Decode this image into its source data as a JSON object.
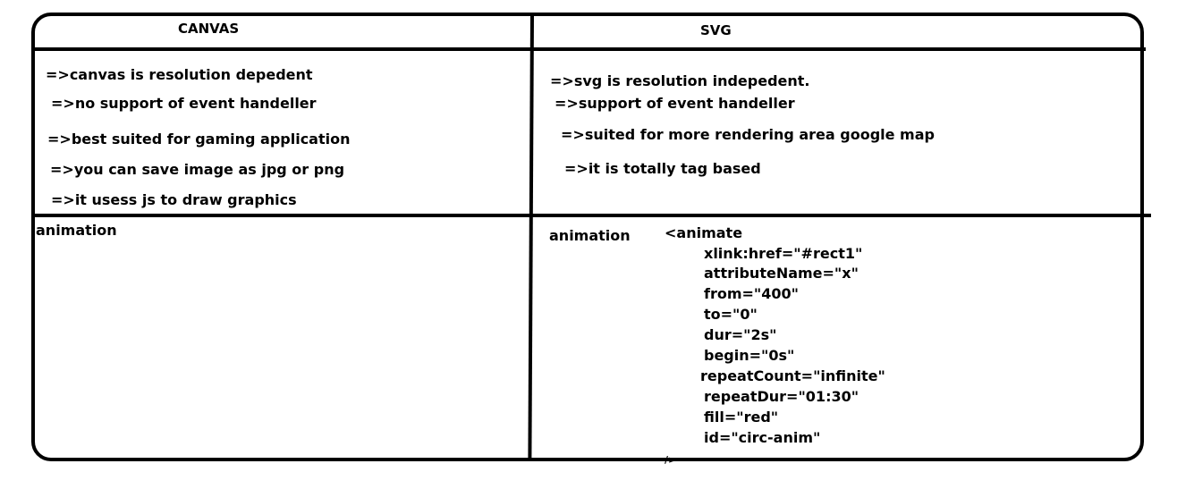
{
  "table": {
    "headers": {
      "canvas": "CANVAS",
      "svg": "SVG"
    },
    "canvas_points": [
      "=>canvas is resolution depedent",
      "=>no support of event handeller",
      "=>best suited for gaming application",
      "=>you can save image as jpg or png",
      "=>it usess js to draw graphics"
    ],
    "svg_points": [
      "=>svg is resolution indepedent.",
      "=>support of event handeller",
      "=>suited for more rendering area google map",
      "=>it is totally tag based"
    ],
    "canvas_animation_label": "animation",
    "svg_animation_label": "animation",
    "svg_animation_code": [
      "<animate",
      "xlink:href=\"#rect1\"",
      "attributeName=\"x\"",
      "from=\"400\"",
      "to=\"0\"",
      "dur=\"2s\"",
      "begin=\"0s\"",
      "repeatCount=\"infinite\"",
      "repeatDur=\"01:30\"",
      "fill=\"red\"",
      "id=\"circ-anim\"",
      "/>"
    ]
  }
}
